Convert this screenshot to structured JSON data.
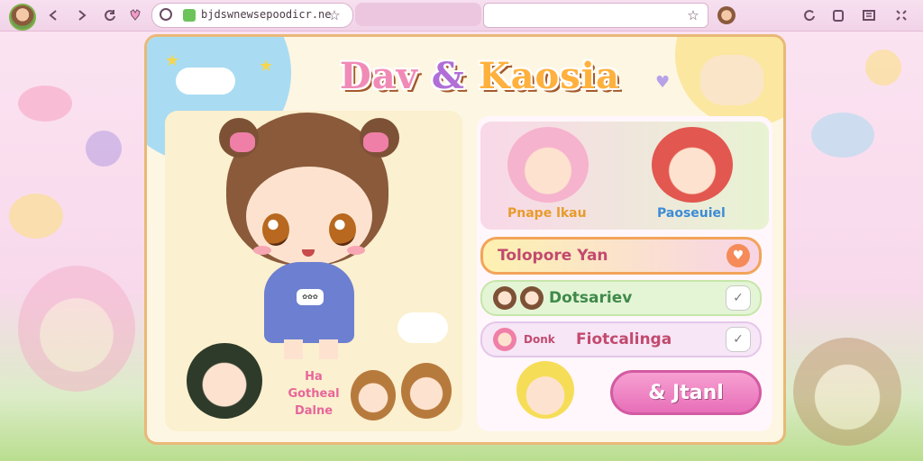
{
  "browser": {
    "url": "bjdswnewsepoodicr.ne",
    "search_value": "",
    "icons": [
      "profile-avatar",
      "back-icon",
      "forward-icon",
      "refresh-icon",
      "extension-icon",
      "site-info-icon",
      "secure-icon",
      "bookmark-star-icon",
      "search-star-icon",
      "account-icon",
      "sync-icon",
      "clipboard-icon",
      "reader-icon",
      "menu-icon"
    ]
  },
  "app": {
    "title_word1": "Dav",
    "title_word2": "&",
    "title_word3": "Kaosia",
    "main_character_tag": "✿✿✿",
    "bottom_label_line1": "Ha",
    "bottom_label_line2": "Gotheal",
    "bottom_label_line3": "Dalne",
    "friends": [
      {
        "label": "Pnape lkau",
        "color": "#e89b2b"
      },
      {
        "label": "Paoseuiel",
        "color": "#3c8bd6"
      }
    ],
    "rows": [
      {
        "text": "Tolopore Yan",
        "button_icon": "heart-icon"
      },
      {
        "text": "Dotsariev",
        "button_icon": "check-icon"
      },
      {
        "text": "Fiotcalinga",
        "avatar_label": "Donk",
        "button_icon": "check-icon"
      }
    ],
    "start_button": "& Jtanl"
  },
  "colors": {
    "accent_pink": "#e76fb8",
    "card_border": "#e9b877",
    "title_pink": "#f08bb6",
    "title_orange": "#ffb13d"
  }
}
